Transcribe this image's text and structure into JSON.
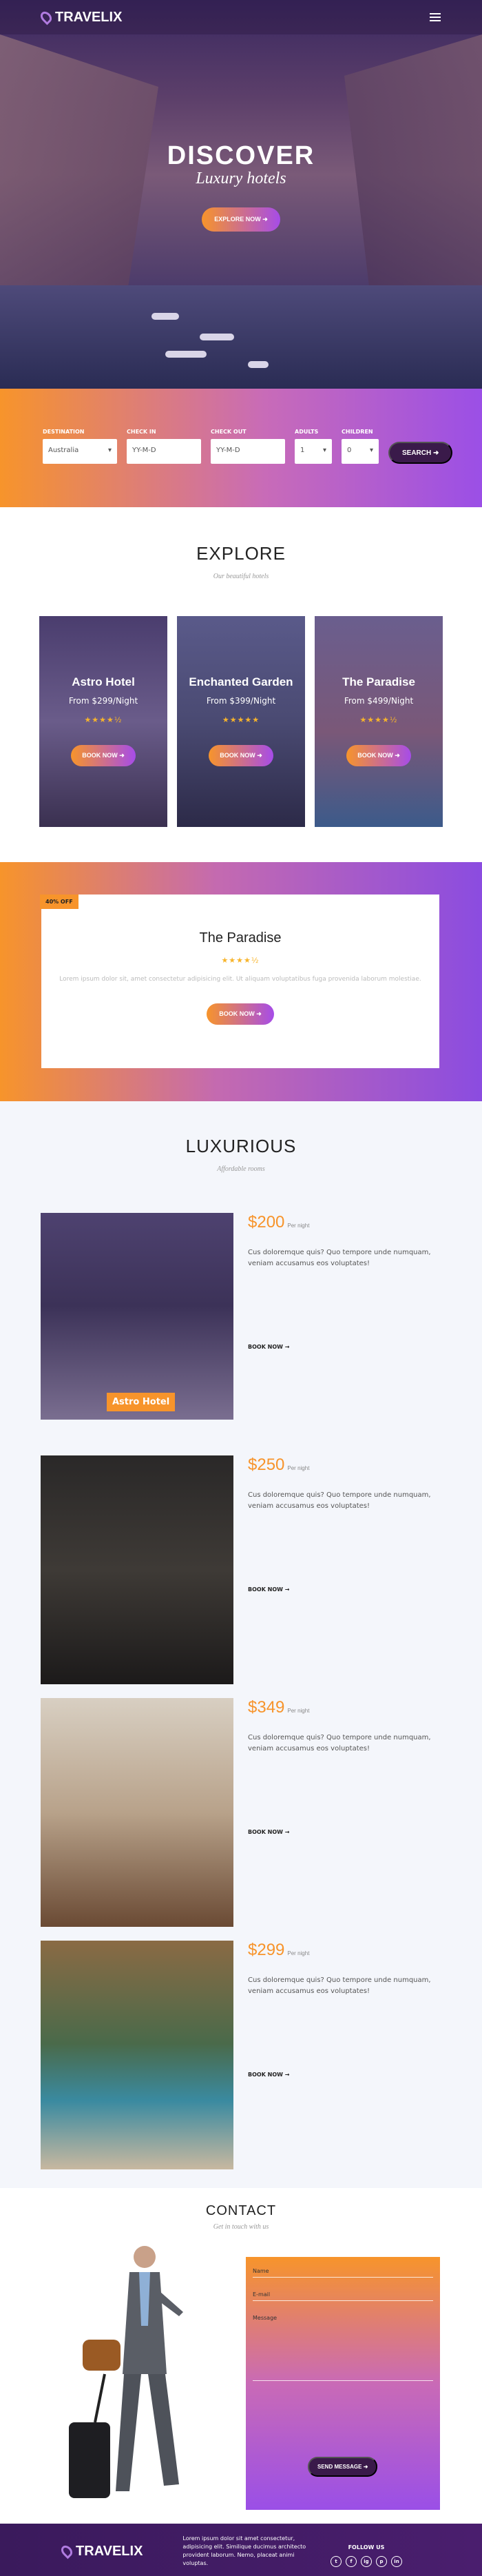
{
  "brand": {
    "name": "TRAVELIX"
  },
  "hero": {
    "title": "DISCOVER",
    "subtitle": "Luxury hotels",
    "button": "EXPLORE NOW"
  },
  "search": {
    "fields": [
      {
        "label": "DESTINATION",
        "value": "Australia"
      },
      {
        "label": "CHECK IN",
        "value": "YY-M-D"
      },
      {
        "label": "CHECK OUT",
        "value": "YY-M-D"
      },
      {
        "label": "ADULTS",
        "value": "1"
      },
      {
        "label": "CHILDREN",
        "value": "0"
      }
    ],
    "button": "SEARCH"
  },
  "explore": {
    "title": "EXPLORE",
    "subtitle": "Our beautiful hotels",
    "cards": [
      {
        "name": "Astro Hotel",
        "price": "From $299/Night",
        "stars": "★★★★½",
        "button": "BOOK NOW"
      },
      {
        "name": "Enchanted Garden",
        "price": "From $399/Night",
        "stars": "★★★★★",
        "button": "BOOK NOW"
      },
      {
        "name": "The Paradise",
        "price": "From $499/Night",
        "stars": "★★★★½",
        "button": "BOOK NOW"
      }
    ]
  },
  "deal": {
    "tag": "40% OFF",
    "title": "The Paradise",
    "stars": "★★★★½",
    "text": "Lorem ipsum dolor sit, amet consectetur adipisicing elit. Ut aliquam voluptatibus fuga provenida laborum molestiae.",
    "button": "BOOK NOW"
  },
  "luxurious": {
    "title": "LUXURIOUS",
    "subtitle": "Affordable rooms",
    "rooms": [
      {
        "price": "$200",
        "unit": "Per night",
        "text": "Cus doloremque quis? Quo tempore unde numquam, veniam accusamus eos voluptates!",
        "link": "BOOK NOW",
        "label": "Astro Hotel"
      },
      {
        "price": "$250",
        "unit": "Per night",
        "text": "Cus doloremque quis? Quo tempore unde numquam, veniam accusamus eos voluptates!",
        "link": "BOOK NOW"
      },
      {
        "price": "$349",
        "unit": "Per night",
        "text": "Cus doloremque quis? Quo tempore unde numquam, veniam accusamus eos voluptates!",
        "link": "BOOK NOW"
      },
      {
        "price": "$299",
        "unit": "Per night",
        "text": "Cus doloremque quis? Quo tempore unde numquam, veniam accusamus eos voluptates!",
        "link": "BOOK NOW"
      }
    ]
  },
  "contact": {
    "title": "CONTACT",
    "subtitle": "Get in touch with us",
    "fields": [
      "Name",
      "E-mail",
      "Message"
    ],
    "button": "SEND MESSAGE"
  },
  "footer": {
    "about": "Lorem ipsum dolor sit amet consectetur, adipisicing elit. Similique ducimus architecto provident laborum. Nemo, placeat animi voluptas.",
    "follow": "FOLLOW US",
    "socials": [
      "t",
      "f",
      "ig",
      "p",
      "in"
    ]
  }
}
